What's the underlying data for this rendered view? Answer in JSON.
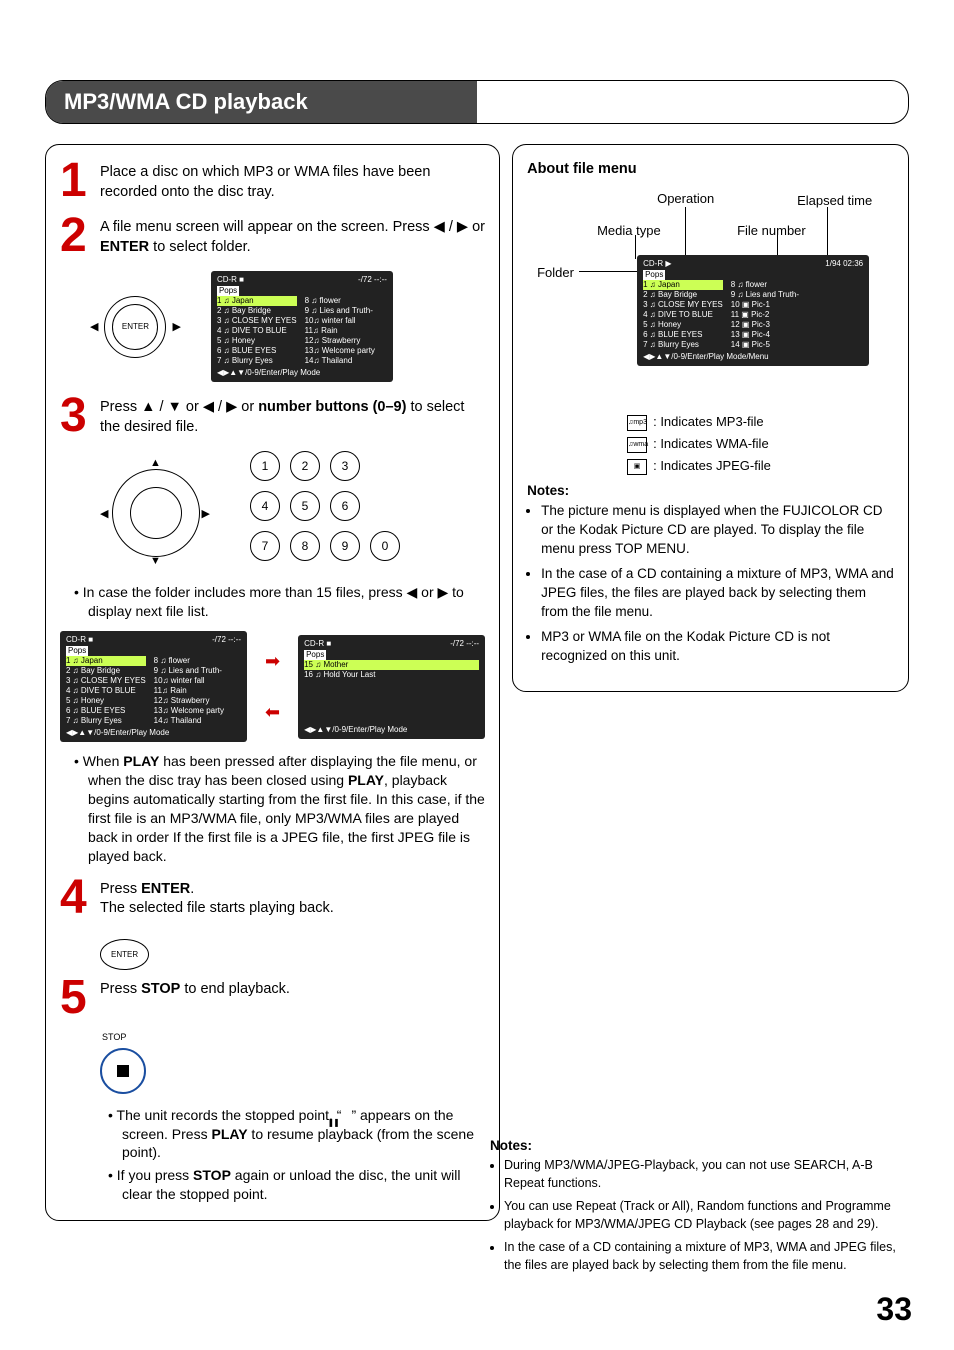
{
  "title": "MP3/WMA CD playback",
  "page_number": "33",
  "steps": {
    "s1": {
      "text": "Place a disc on which MP3 or WMA files have been recorded onto the disc tray."
    },
    "s2": {
      "text_a": "A file menu screen will appear on the screen. Press ",
      "text_b": " or ",
      "enter": "ENTER",
      "text_c": " to select folder."
    },
    "s3": {
      "text_a": "Press ",
      "text_b": " or ",
      "text_c": " or ",
      "nb": "number buttons (0–9)",
      "text_d": " to select the desired file."
    },
    "s3_sub": "•  In case the folder includes more than 15 files, press ◀ or ▶ to display next file list.",
    "s3_play_a": "•  When ",
    "s3_play": "PLAY",
    "s3_play_b": " has been pressed after displaying the file menu, or when the disc tray has been closed using ",
    "s3_play_c": ", playback begins automatically starting from the first file.  In this case, if the first file is an MP3/WMA file, only MP3/WMA files are played back in order If the first file is a JPEG file, the first JPEG file is played back.",
    "s4": {
      "text_a": "Press ",
      "enter": "ENTER",
      "text_b": ".",
      "text_c": "The selected file starts playing back."
    },
    "s5": {
      "text_a": "Press ",
      "stop": "STOP",
      "text_b": " to end playback."
    },
    "s5_stop_label": "STOP",
    "s5_b1_a": "•  The unit records the stopped point. “",
    "s5_b1_b": "” appears on the screen. Press ",
    "s5_b1_play": "PLAY",
    "s5_b1_c": " to resume playback (from the scene point).",
    "s5_b2_a": "•  If you press ",
    "s5_b2_stop": "STOP",
    "s5_b2_b": " again or unload the disc, the unit will clear the stopped point."
  },
  "enter_label": "ENTER",
  "numpad": [
    "1",
    "2",
    "3",
    "4",
    "5",
    "6",
    "7",
    "8",
    "9",
    "0"
  ],
  "file_menu": {
    "header_media": "CD-R ■",
    "header_counter": "-/72   --:--",
    "folder": "Pops",
    "left_col": [
      "1 ♫ Japan",
      "2 ♫ Bay Bridge",
      "3 ♫ CLOSE MY EYES",
      "4 ♫ DIVE TO BLUE",
      "5 ♫ Honey",
      "6 ♫ BLUE EYES",
      "7 ♫ Blurry Eyes"
    ],
    "right_col": [
      "8 ♫ flower",
      "9 ♫ Lies and Truth-",
      "10♫ winter fall",
      "11♫ Rain",
      "12♫ Strawberry",
      "13♫ Welcome party",
      "14♫ Thailand"
    ],
    "footer": "◀▶▲▼/0-9/Enter/Play Mode"
  },
  "file_menu2": {
    "folder": "Pops",
    "items": [
      "15 ♫ Mother",
      "16 ♫ Hold Your Last"
    ],
    "footer": "◀▶▲▼/0-9/Enter/Play Mode"
  },
  "about": {
    "heading": "About file menu",
    "labels": {
      "operation": "Operation",
      "elapsed": "Elapsed time",
      "media": "Media type",
      "filenum": "File number",
      "folder": "Folder"
    },
    "header_media": "CD-R ▶",
    "header_counter": "1/94   02:36",
    "folder": "Pops",
    "left_col": [
      "1 ♫ Japan",
      "2 ♫ Bay Bridge",
      "3 ♫ CLOSE MY EYES",
      "4 ♫ DIVE TO BLUE",
      "5 ♫ Honey",
      "6 ♫ BLUE EYES",
      "7 ♫ Blurry Eyes"
    ],
    "right_col": [
      "8 ♫ flower",
      "9 ♫ Lies and Truth-",
      "10 ▣ Pic-1",
      "11 ▣ Pic-2",
      "12 ▣ Pic-3",
      "13 ▣ Pic-4",
      "14 ▣ Pic-5"
    ],
    "footer": "◀▶▲▼/0-9/Enter/Play Mode/Menu",
    "legend_mp3": ": Indicates MP3-file",
    "legend_wma": ": Indicates WMA-file",
    "legend_jpeg": ": Indicates JPEG-file"
  },
  "notes_top_h": "Notes:",
  "notes_top": [
    "The picture menu is displayed when the FUJICOLOR CD or the Kodak Picture CD are played. To display the file menu press TOP MENU.",
    "In the case of a CD containing a mixture of MP3, WMA and JPEG files,  the files are played back by selecting them from the file menu.",
    "MP3 or WMA file on the Kodak Picture CD is not recognized on this unit."
  ],
  "notes_bottom_h": "Notes:",
  "notes_bottom": [
    "During MP3/WMA/JPEG-Playback, you can not use SEARCH, A-B Repeat functions.",
    "You can use Repeat (Track or All), Random functions and Programme playback for MP3/WMA/JPEG CD Playback (see pages 28 and 29).",
    "In the case of a CD containing a mixture of MP3, WMA and JPEG files, the files are played back by selecting them from the file menu."
  ]
}
